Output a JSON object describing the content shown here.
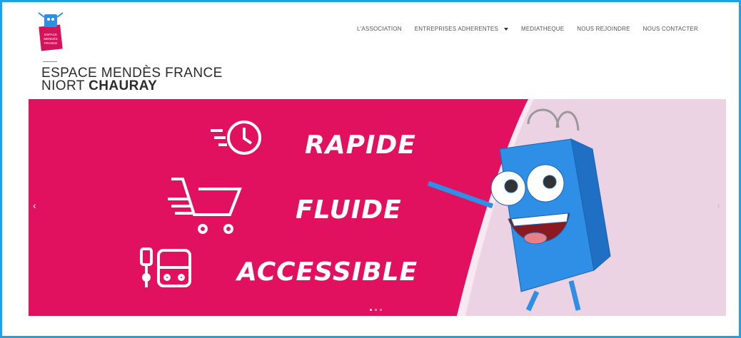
{
  "logo": {
    "lines": [
      "ESPACE",
      "MENDÈS",
      "FRANCE"
    ]
  },
  "nav": {
    "items": [
      "L'ASSOCIATION",
      "ENTREPRISES ADHERENTES",
      "MEDIATHEQUE",
      "NOUS REJOINDRE",
      "NOUS CONTACTER"
    ]
  },
  "site_title": {
    "line1": "ESPACE MENDÈS FRANCE",
    "line2_light": "NIORT ",
    "line2_bold": "CHAURAY"
  },
  "banner": {
    "words": [
      "RAPIDE",
      "FLUIDE",
      "ACCESSIBLE"
    ],
    "prev": "‹",
    "next": "›"
  },
  "colors": {
    "accent": "#e2115f",
    "pink_light": "#ecd3e3",
    "bag_blue": "#2f8fe6",
    "frame": "#1aa3e8"
  }
}
